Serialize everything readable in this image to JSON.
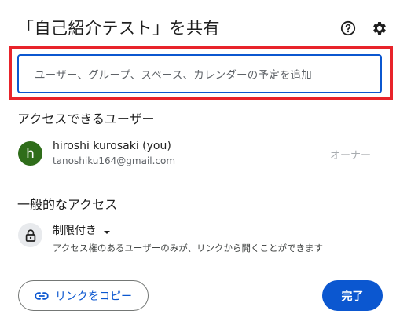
{
  "dialog": {
    "title": "「自己紹介テスト」を共有",
    "help_icon": "help-circle-icon",
    "settings_icon": "gear-icon"
  },
  "search": {
    "placeholder": "ユーザー、グループ、スペース、カレンダーの予定を追加"
  },
  "users_section": {
    "title": "アクセスできるユーザー",
    "users": [
      {
        "avatar_letter": "h",
        "avatar_color": "#2f6d1a",
        "name": "hiroshi kurosaki (you)",
        "email": "tanoshiku164@gmail.com",
        "role": "オーナー"
      }
    ]
  },
  "general_access": {
    "title": "一般的なアクセス",
    "icon": "lock-icon",
    "selected": "制限付き",
    "description": "アクセス権のあるユーザーのみが、リンクから開くことができます"
  },
  "footer": {
    "copy_link_label": "リンクをコピー",
    "done_label": "完了"
  },
  "colors": {
    "accent": "#0b57d0",
    "highlight": "#e8232a"
  }
}
